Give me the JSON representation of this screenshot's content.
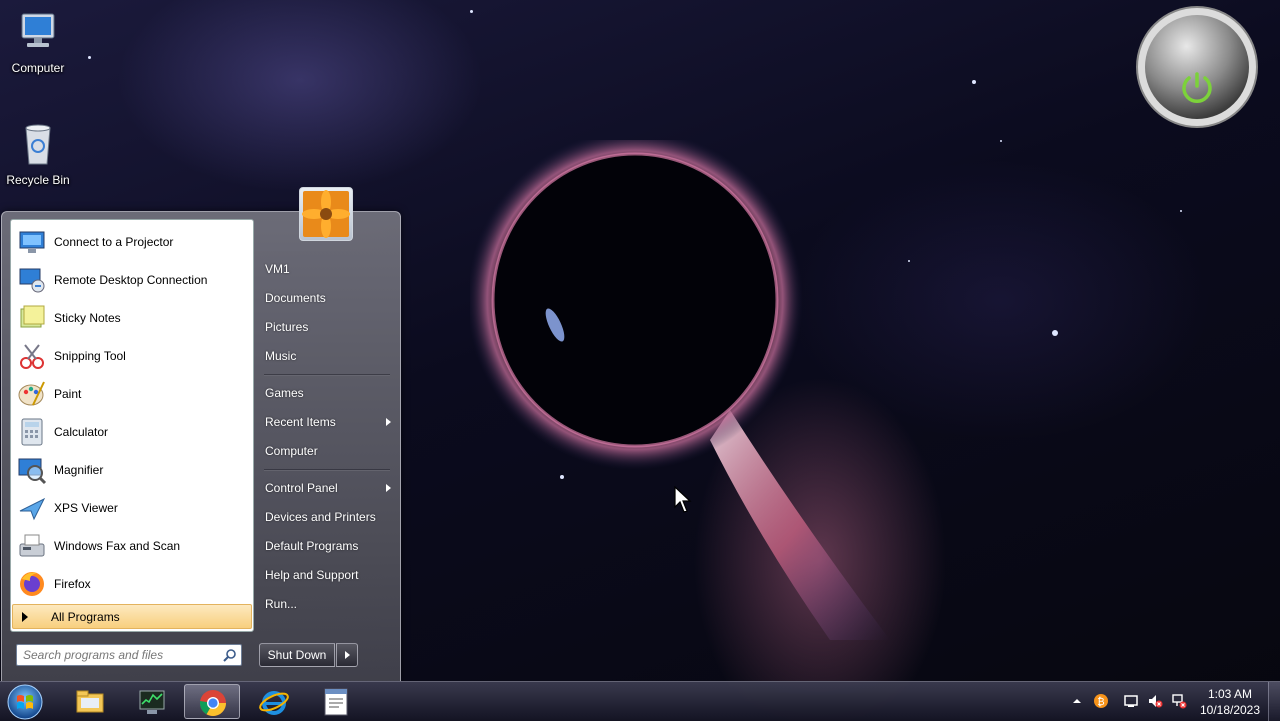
{
  "desktop": {
    "icons": [
      {
        "label": "Computer",
        "icon": "computer-icon"
      },
      {
        "label": "Recycle Bin",
        "icon": "recycle-bin-icon"
      }
    ],
    "gadget": {
      "icon": "power-icon",
      "accent": "#7cd23a"
    }
  },
  "start_menu": {
    "programs": [
      {
        "label": "Connect to a Projector",
        "icon": "projector-icon"
      },
      {
        "label": "Remote Desktop Connection",
        "icon": "remote-desktop-icon"
      },
      {
        "label": "Sticky Notes",
        "icon": "sticky-notes-icon"
      },
      {
        "label": "Snipping Tool",
        "icon": "snipping-tool-icon"
      },
      {
        "label": "Paint",
        "icon": "paint-icon"
      },
      {
        "label": "Calculator",
        "icon": "calculator-icon"
      },
      {
        "label": "Magnifier",
        "icon": "magnifier-icon"
      },
      {
        "label": "XPS Viewer",
        "icon": "xps-viewer-icon"
      },
      {
        "label": "Windows Fax and Scan",
        "icon": "fax-scan-icon"
      },
      {
        "label": "Firefox",
        "icon": "firefox-icon"
      }
    ],
    "all_programs_label": "All Programs",
    "search_placeholder": "Search programs and files",
    "user_picture_icon": "flower-icon",
    "right_items": [
      {
        "label": "VM1",
        "submenu": false
      },
      {
        "label": "Documents",
        "submenu": false
      },
      {
        "label": "Pictures",
        "submenu": false
      },
      {
        "label": "Music",
        "submenu": false
      },
      {
        "label": "Games",
        "submenu": false
      },
      {
        "label": "Recent Items",
        "submenu": true
      },
      {
        "label": "Computer",
        "submenu": false
      },
      {
        "label": "Control Panel",
        "submenu": true
      },
      {
        "label": "Devices and Printers",
        "submenu": false
      },
      {
        "label": "Default Programs",
        "submenu": false
      },
      {
        "label": "Help and Support",
        "submenu": false
      },
      {
        "label": "Run...",
        "submenu": false
      }
    ],
    "shutdown_label": "Shut Down"
  },
  "taskbar": {
    "pinned": [
      {
        "icon": "file-explorer-icon",
        "active": false
      },
      {
        "icon": "task-manager-icon",
        "active": false
      },
      {
        "icon": "chrome-icon",
        "active": true
      },
      {
        "icon": "internet-explorer-icon",
        "active": false
      },
      {
        "icon": "notepad-window-icon",
        "active": false
      }
    ],
    "tray_icons": [
      "show-hidden-icons-icon",
      "bitcoin-icon",
      "action-center-icon",
      "volume-muted-icon",
      "network-error-icon"
    ],
    "clock": {
      "time": "1:03 AM",
      "date": "10/18/2023"
    }
  }
}
